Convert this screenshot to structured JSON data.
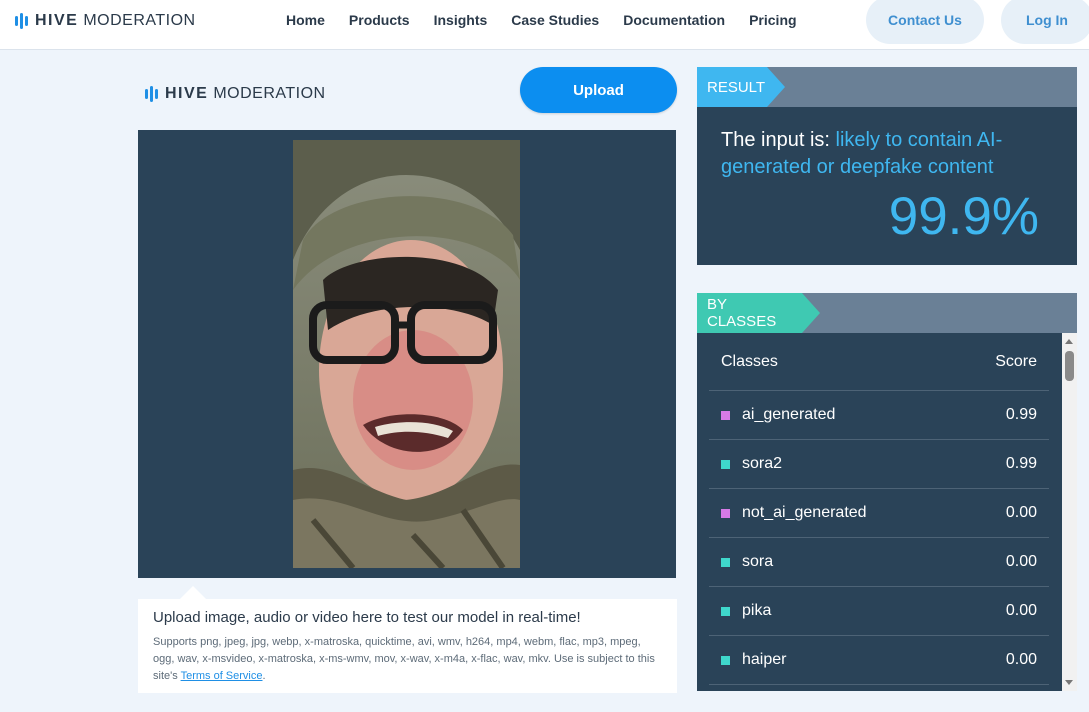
{
  "nav": {
    "brand_bold": "HIVE",
    "brand_light": "MODERATION",
    "links": [
      "Home",
      "Products",
      "Insights",
      "Case Studies",
      "Documentation",
      "Pricing"
    ],
    "contact_label": "Contact Us",
    "login_label": "Log In"
  },
  "left": {
    "brand_bold": "HIVE",
    "brand_light": "MODERATION",
    "upload_label": "Upload",
    "info_headline": "Upload image, audio or video here to test our model in real-time!",
    "info_formats": "Supports png, jpeg, jpg, webp, x-matroska, quicktime, avi, wmv, h264, mp4, webm, flac, mp3, mpeg, ogg, wav, x-msvideo, x-matroska, x-ms-wmv, mov, x-wav, x-m4a, x-flac, wav, mkv. Use is subject to this site's",
    "terms_link": "Terms of Service",
    "terms_after": "."
  },
  "result": {
    "tag": "RESULT",
    "prefix": "The input is: ",
    "verdict": "likely to contain AI-generated or deepfake content",
    "percent": "99.9%",
    "highlight_color": "#3fb7f0"
  },
  "classes": {
    "tag": "BY CLASSES",
    "header_class": "Classes",
    "header_score": "Score",
    "rows": [
      {
        "name": "ai_generated",
        "score": "0.99",
        "color": "#d67ae6"
      },
      {
        "name": "sora2",
        "score": "0.99",
        "color": "#3fd8cc"
      },
      {
        "name": "not_ai_generated",
        "score": "0.00",
        "color": "#d67ae6"
      },
      {
        "name": "sora",
        "score": "0.00",
        "color": "#3fd8cc"
      },
      {
        "name": "pika",
        "score": "0.00",
        "color": "#3fd8cc"
      },
      {
        "name": "haiper",
        "score": "0.00",
        "color": "#3fd8cc"
      }
    ]
  }
}
